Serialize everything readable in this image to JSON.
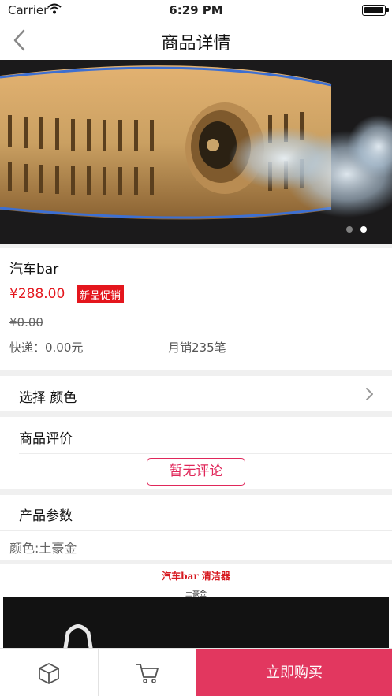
{
  "status_bar": {
    "carrier": "Carrier",
    "time": "6:29 PM"
  },
  "nav": {
    "title": "商品详情",
    "back_icon": "chevron-left-icon"
  },
  "banner": {
    "image": "gold-car-air-purifier-with-mist",
    "slides": 2,
    "active_slide": 1
  },
  "product": {
    "name": "汽车bar",
    "price": "¥288.00",
    "badge": "新品促销",
    "original_price": "¥0.00",
    "shipping": "快递：0.00元",
    "sales": "月销235笔"
  },
  "spec_select": {
    "label": "选择 颜色"
  },
  "reviews": {
    "title": "商品评价",
    "empty_button": "暂无评论"
  },
  "params": {
    "title": "产品参数",
    "color": "颜色:土豪金"
  },
  "detail": {
    "title": "汽车bar 清洁器",
    "subtitle": "土豪金"
  },
  "bottom_bar": {
    "box_icon": "cube-icon",
    "cart_icon": "cart-icon",
    "buy_label": "立即购买"
  },
  "colors": {
    "accent": "#e2375f",
    "price_red": "#e4161d"
  }
}
